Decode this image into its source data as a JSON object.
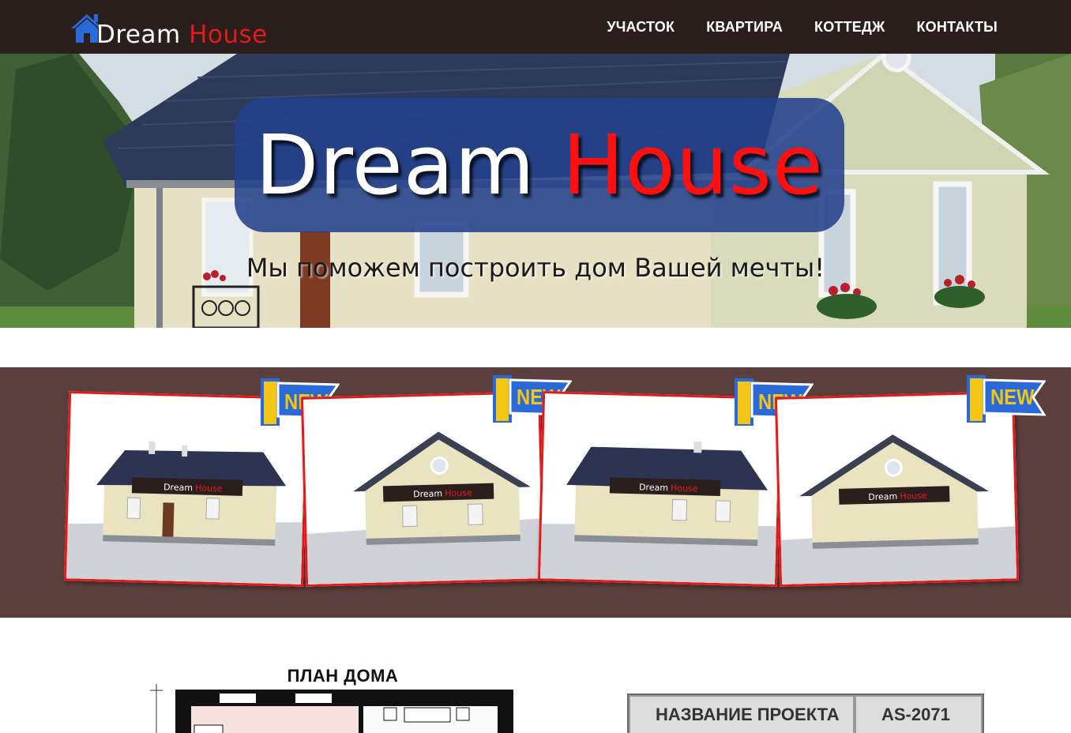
{
  "nav": {
    "logo": {
      "word1": "Dream",
      "word2": "House",
      "icon": "house-icon"
    },
    "menu": [
      {
        "label": "УЧАСТОК"
      },
      {
        "label": "КВАРТИРА"
      },
      {
        "label": "КОТТЕДЖ"
      },
      {
        "label": "КОНТАКТЫ"
      }
    ]
  },
  "hero": {
    "title_word1": "Dream",
    "title_word2": "House",
    "subtitle": "Мы поможем построить дом Вашей мечты!"
  },
  "gallery": {
    "badge_text": "NEW",
    "cards": [
      {
        "sign_word1": "Dream",
        "sign_word2": "House"
      },
      {
        "sign_word1": "Dream",
        "sign_word2": "House"
      },
      {
        "sign_word1": "Dream",
        "sign_word2": "House"
      },
      {
        "sign_word1": "Dream",
        "sign_word2": "House"
      }
    ]
  },
  "plan": {
    "title": "ПЛАН ДОМА"
  },
  "spec": {
    "rows": [
      {
        "label": "НАЗВАНИЕ ПРОЕКТА",
        "value": "AS-2071"
      }
    ]
  },
  "colors": {
    "nav_bg": "#2b1f1e",
    "accent_red": "#e21b1b",
    "hero_box": "#23418c",
    "gallery_bg": "#5a3f3d",
    "badge_blue": "#2a6ad8",
    "badge_yellow": "#f3c515"
  }
}
